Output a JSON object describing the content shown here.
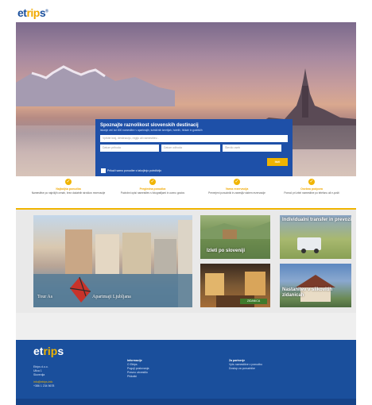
{
  "header": {
    "logo_main": "et",
    "logo_accent": "rip",
    "logo_tail": "s",
    "logo_reg": "®"
  },
  "search": {
    "title": "Spoznajte raznolikost slovenskih destinacij",
    "subtitle": "Iskanje več kot 800 namestitev v apartmajih, turističnih kmetijah, hotelih, hiškah in gostiščih",
    "main_placeholder": "Vpišite kraj, destinacijo, regijo ali namestitev...",
    "field_1": "Datum prihoda",
    "field_2": "Datum odhoda",
    "field_3": "Število oseb",
    "button": "Išči",
    "checkbox_label": "Prikaži samo ponudbe s takojšnjo potrditvijo"
  },
  "features": [
    {
      "title": "Najboljša ponudba",
      "text": "Namestitve po najnižjih cenah, brez dodatnih stroškov rezervacije"
    },
    {
      "title": "Pregledna ponudba",
      "text": "Podrobni opisi namestitev s fotografijami in oceno gostov"
    },
    {
      "title": "Varna rezervacija",
      "text": "Preverjeni ponudniki in zanesljiv sistem rezervacije"
    },
    {
      "title": "Osebna podpora",
      "text": "Pomoč pri izbiri namestitve po telefonu ali e-pošti"
    }
  ],
  "tiles": {
    "big_label": "Tour As",
    "big_caption": "Apartmaji Ljubljana",
    "t1_caption": "Izleti po sloveniji",
    "t2_caption": "Individualni transfer in prevozi",
    "t4_caption": "Nastanitev v slikovitih zidanicah",
    "t3_badge": "ZIDANICA"
  },
  "footer": {
    "logo_main": "et",
    "logo_accent": "rip",
    "logo_tail": "s",
    "company": [
      "Etrips d.o.o.",
      "Ulica 1",
      "Slovenija"
    ],
    "email": "info@etrips.info",
    "phone": "+386 1 234 5678",
    "info_head": "Informacije",
    "info_links": [
      "O Etrips",
      "Pogoji poslovanja",
      "Pravno obvestilo",
      "Piškotki"
    ],
    "partner_head": "Za partnerje",
    "partner_links": [
      "Vpis namestitve v ponudbo",
      "Dostop za ponudnike"
    ]
  },
  "colors": {
    "brand_blue": "#1a4f9c",
    "accent_yellow": "#f0b400"
  }
}
